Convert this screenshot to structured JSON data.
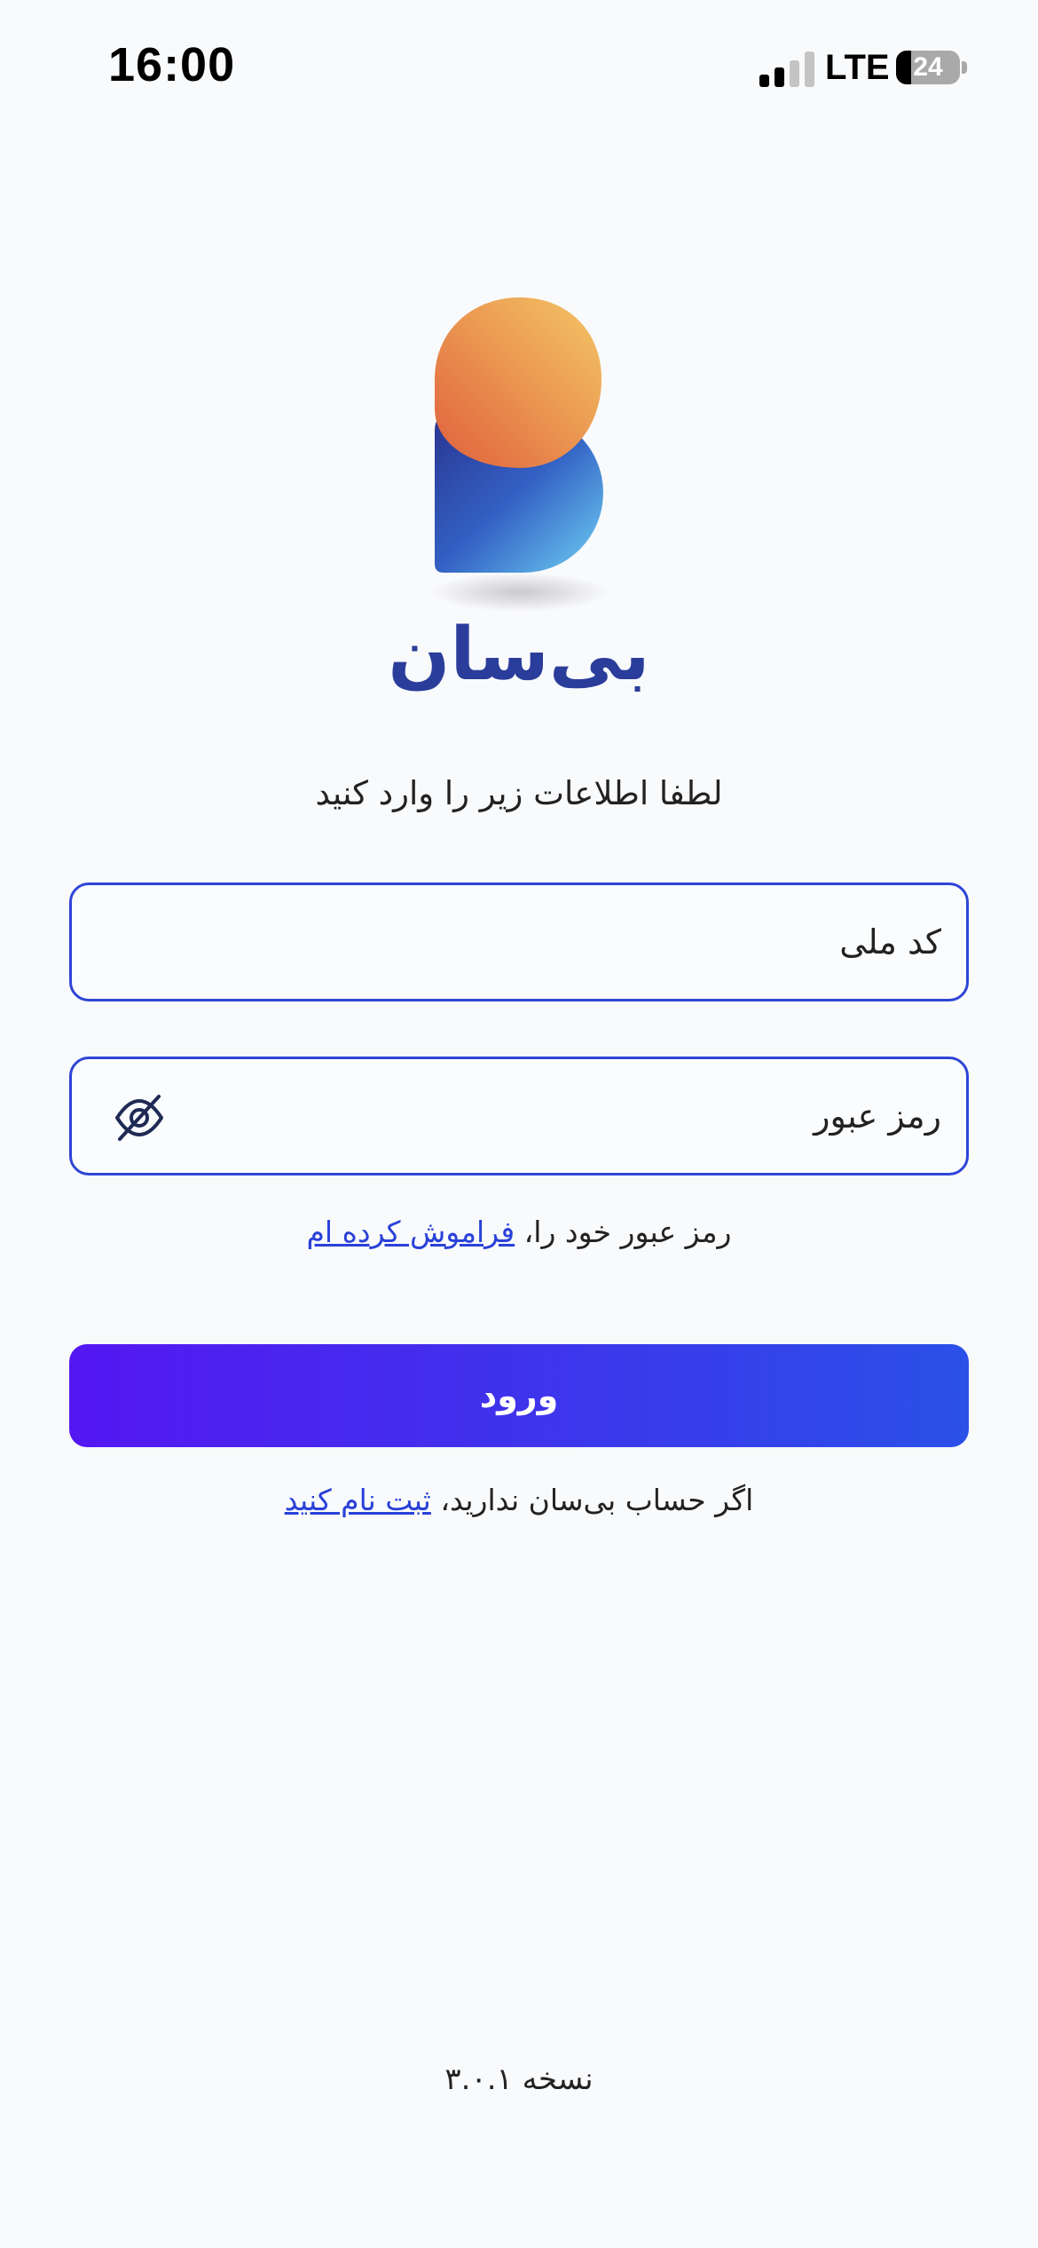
{
  "status_bar": {
    "time": "16:00",
    "network": "LTE",
    "battery_level": "24",
    "battery_fraction": 0.24,
    "signal_bars_active": 2,
    "signal_bars_total": 4
  },
  "brand": {
    "name": "بی‌سان",
    "colors": {
      "orange_light": "#f2bf63",
      "orange_dark": "#e06a40",
      "blue_dark": "#2b3d9c",
      "blue_light": "#6ccaf0",
      "wordmark": "#2a3d9a"
    }
  },
  "login": {
    "instruction": "لطفا اطلاعات زیر را وارد کنید",
    "national_code_placeholder": "کد ملی",
    "password_placeholder": "رمز عبور",
    "password_toggle_icon": "eye-off-icon",
    "forgot_prefix": "رمز عبور خود را،",
    "forgot_link": "فراموش کرده ام",
    "submit_label": "ورود",
    "register_prefix": "اگر حساب بی‌سان ندارید،",
    "register_link": "ثبت نام کنید"
  },
  "footer": {
    "version_label": "نسخه",
    "version_number": "۳.۰.۱"
  },
  "theme": {
    "accent": "#2f45d6",
    "button_gradient_start": "#5417f2",
    "button_gradient_end": "#2a50e8",
    "link": "#2a41d8",
    "background": "#f9fafc"
  }
}
